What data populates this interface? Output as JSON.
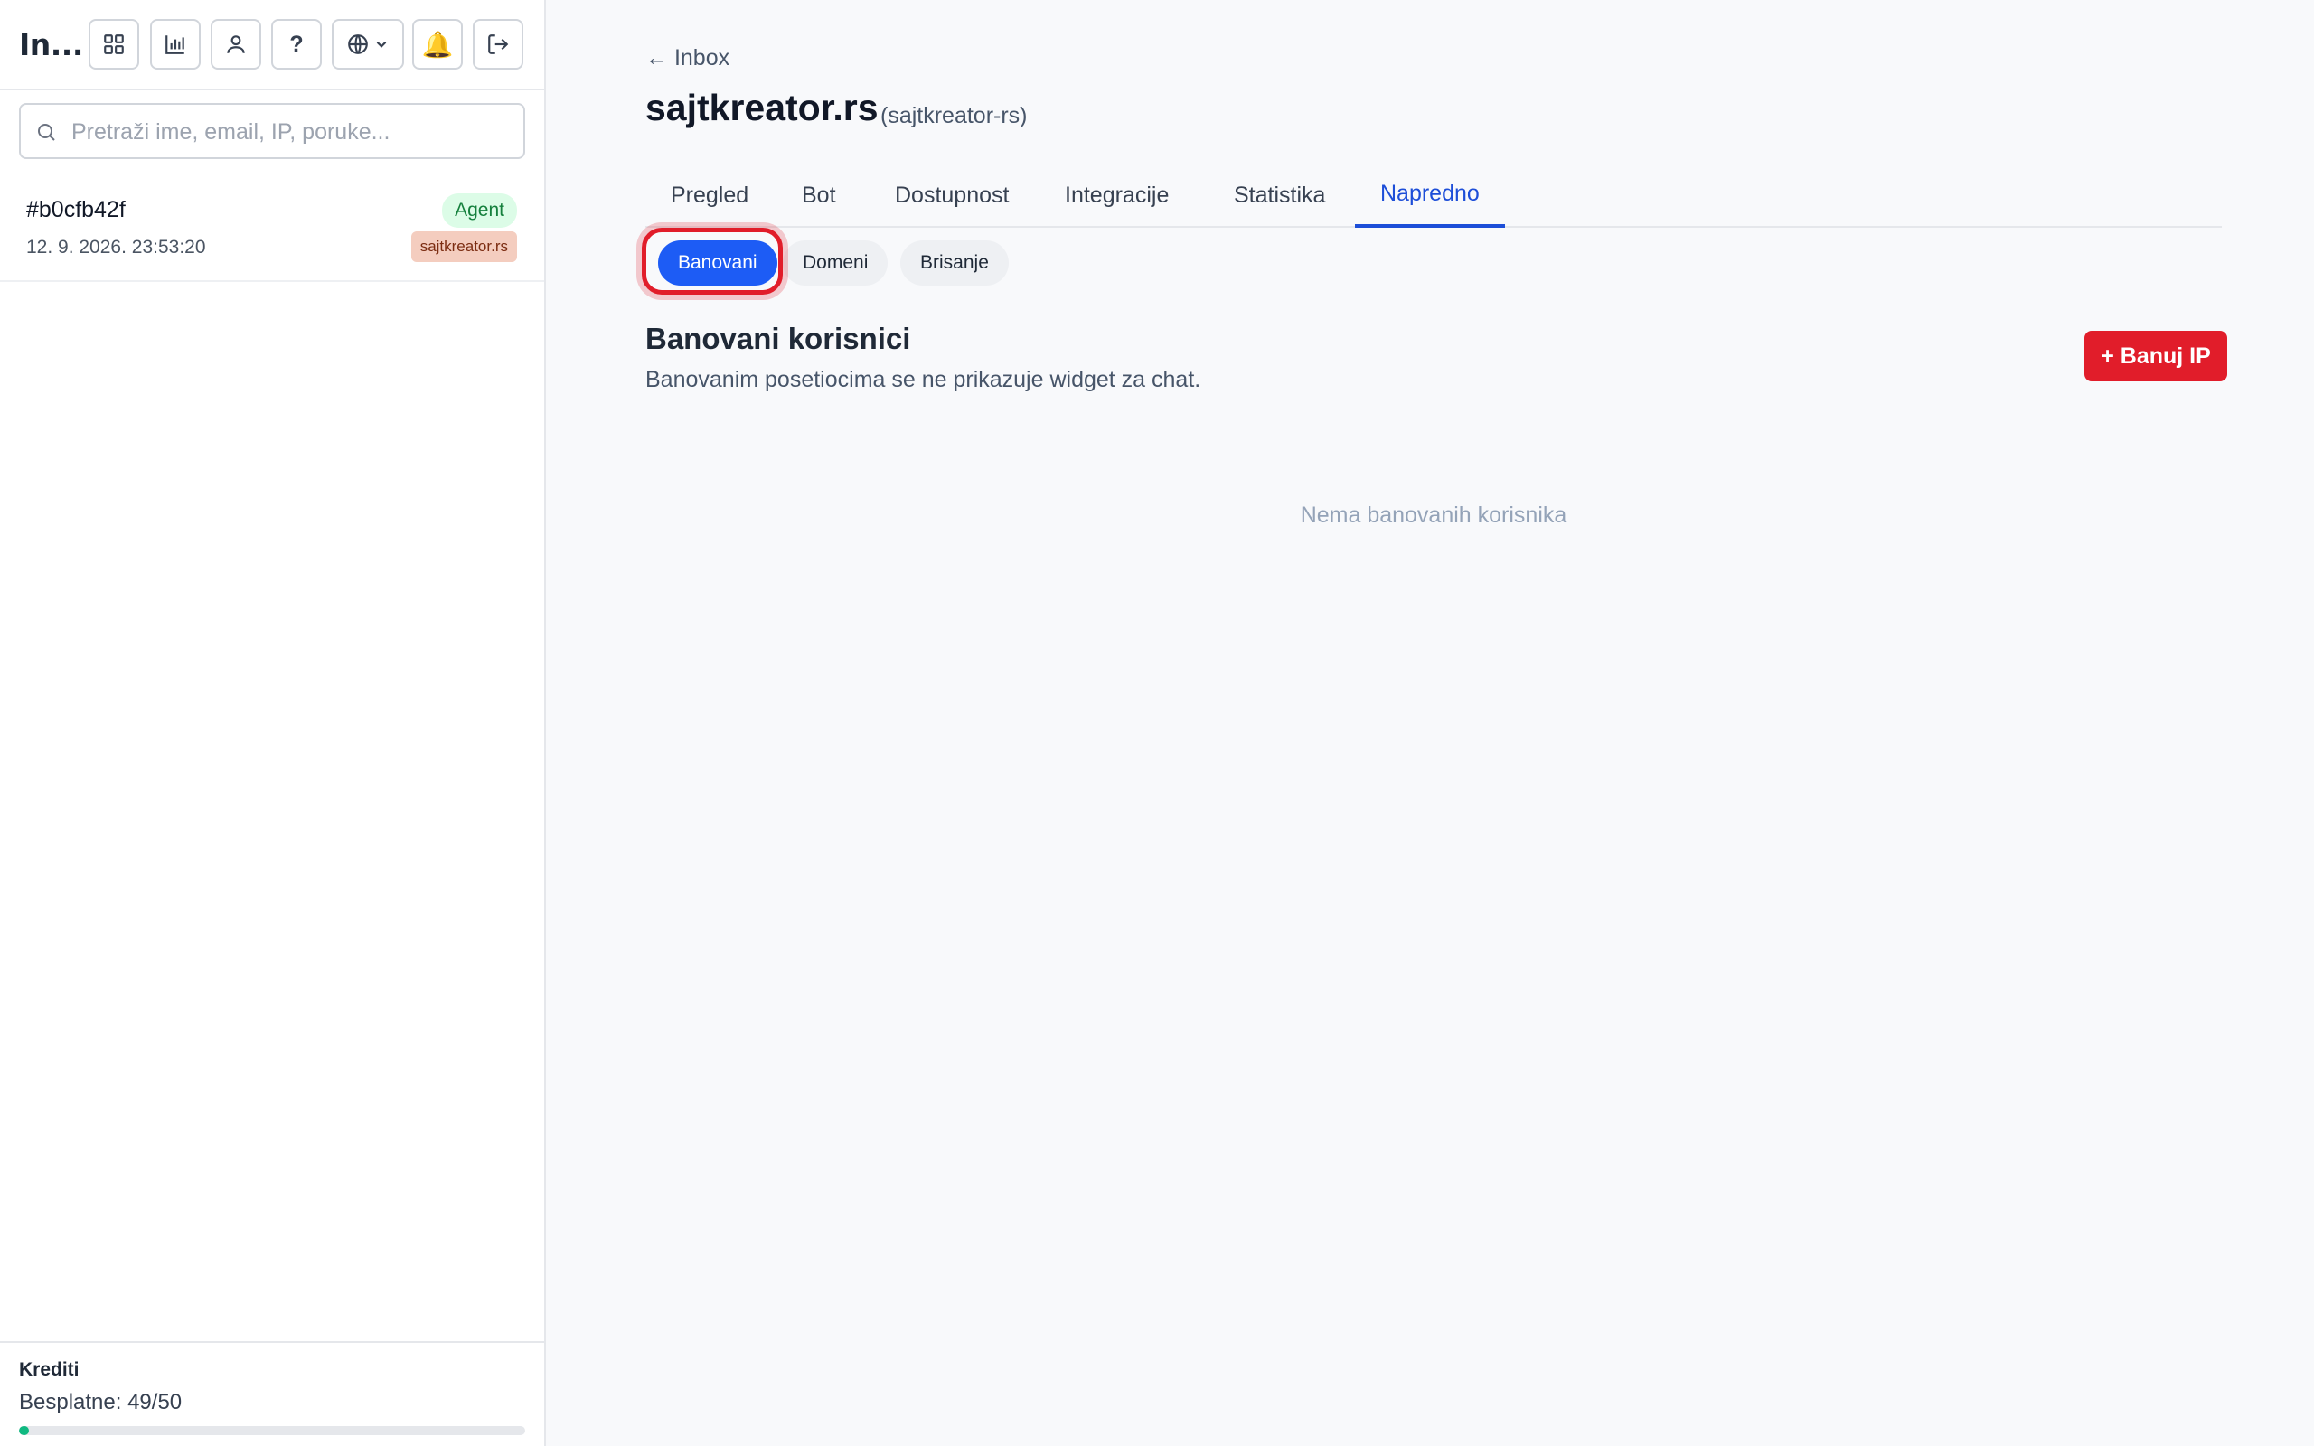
{
  "sidebar": {
    "app_title": "In...",
    "toolbar": [
      {
        "name": "dashboard-button",
        "icon": "grid-icon"
      },
      {
        "name": "stats-button",
        "icon": "bar-chart-icon"
      },
      {
        "name": "profile-button",
        "icon": "user-icon"
      },
      {
        "name": "help-button",
        "icon": "question-icon",
        "label": "?"
      },
      {
        "name": "language-button",
        "icon": "globe-icon"
      },
      {
        "name": "notifications-button",
        "icon": "bell-icon",
        "glyph": "🔔"
      },
      {
        "name": "logout-button",
        "icon": "logout-icon"
      }
    ],
    "search": {
      "placeholder": "Pretraži ime, email, IP, poruke...",
      "value": ""
    },
    "conversations": [
      {
        "id": "#b0cfb42f",
        "time": "12. 9. 2026. 23:53:20",
        "status": "Agent",
        "site": "sajtkreator.rs"
      }
    ],
    "credits": {
      "label": "Krediti",
      "value": "Besplatne: 49/50",
      "used": 1,
      "total": 50
    }
  },
  "main": {
    "back_link": "← Inbox",
    "title": "sajtkreator.rs",
    "slug": "(sajtkreator-rs)",
    "tabs": [
      {
        "label": "Pregled",
        "active": false
      },
      {
        "label": "Bot",
        "active": false
      },
      {
        "label": "Dostupnost",
        "active": false
      },
      {
        "label": "Integracije",
        "active": false
      },
      {
        "label": "Statistika",
        "active": false
      },
      {
        "label": "Napredno",
        "active": true
      }
    ],
    "subtabs": [
      {
        "label": "Banovani",
        "active": true
      },
      {
        "label": "Domeni",
        "active": false
      },
      {
        "label": "Brisanje",
        "active": false
      }
    ],
    "section": {
      "title": "Banovani korisnici",
      "description": "Banovanim posetiocima se ne prikazuje widget za chat.",
      "ban_button": "+ Banuj IP",
      "empty_text": "Nema banovanih korisnika"
    }
  },
  "colors": {
    "accent": "#1d4ed8",
    "pill_active": "#1d5cf5",
    "danger": "#e11d2a",
    "success": "#10b981"
  }
}
